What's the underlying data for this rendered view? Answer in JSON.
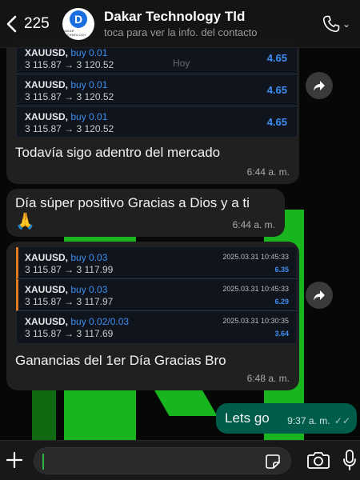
{
  "header": {
    "back_count": "225",
    "contact_name": "Dakar Technology Tld",
    "contact_subtitle": "toca para ver la info. del contacto",
    "avatar_logo_letter": "D",
    "avatar_logo_text": "DAKAR TECHNOLOGY"
  },
  "date_chip": "Hoy",
  "messages": [
    {
      "trades": [
        {
          "symbol": "XAUUSD,",
          "direction": "buy 0.01",
          "prices": "3 115.87 → 3 120.52",
          "profit": "4.65"
        },
        {
          "symbol": "XAUUSD,",
          "direction": "buy 0.01",
          "prices": "3 115.87 → 3 120.52",
          "profit": "4.65"
        },
        {
          "symbol": "XAUUSD,",
          "direction": "buy 0.01",
          "prices": "3 115.87 → 3 120.52",
          "profit": "4.65"
        }
      ],
      "text": "Todavía sigo adentro del mercado",
      "time": "6:44 a. m."
    },
    {
      "text": "Día súper positivo Gracias a Dios y a ti",
      "emoji": "🙏",
      "time": "6:44 a. m."
    },
    {
      "trades": [
        {
          "symbol": "XAUUSD,",
          "direction": "buy 0.03",
          "prices": "3 115.87 → 3 117.99",
          "date": "2025.03.31 10:45:33",
          "profit": "6.35"
        },
        {
          "symbol": "XAUUSD,",
          "direction": "buy 0.03",
          "prices": "3 115.87 → 3 117.97",
          "date": "2025.03.31 10:45:33",
          "profit": "6.29"
        },
        {
          "symbol": "XAUUSD,",
          "direction": "buy 0.02/0.03",
          "prices": "3 115.87 → 3 117.69",
          "date": "2025.03.31 10:30:35",
          "profit": "3.64"
        }
      ],
      "text": "Ganancias del 1er Día Gracias Bro",
      "time": "6:48 a. m."
    },
    {
      "text": "Lets go",
      "time": "9:37 a. m.",
      "ticks": "✓✓"
    }
  ],
  "colors": {
    "accent_blue": "#3e8ef0",
    "outgoing_bubble": "#005c4b",
    "wallpaper_green": "#19b51f"
  },
  "icons": {
    "back": "chevron-left-icon",
    "call": "phone-icon",
    "forward": "forward-arrow-icon",
    "plus": "plus-icon",
    "sticker": "sticker-icon",
    "camera": "camera-icon",
    "mic": "microphone-icon"
  }
}
